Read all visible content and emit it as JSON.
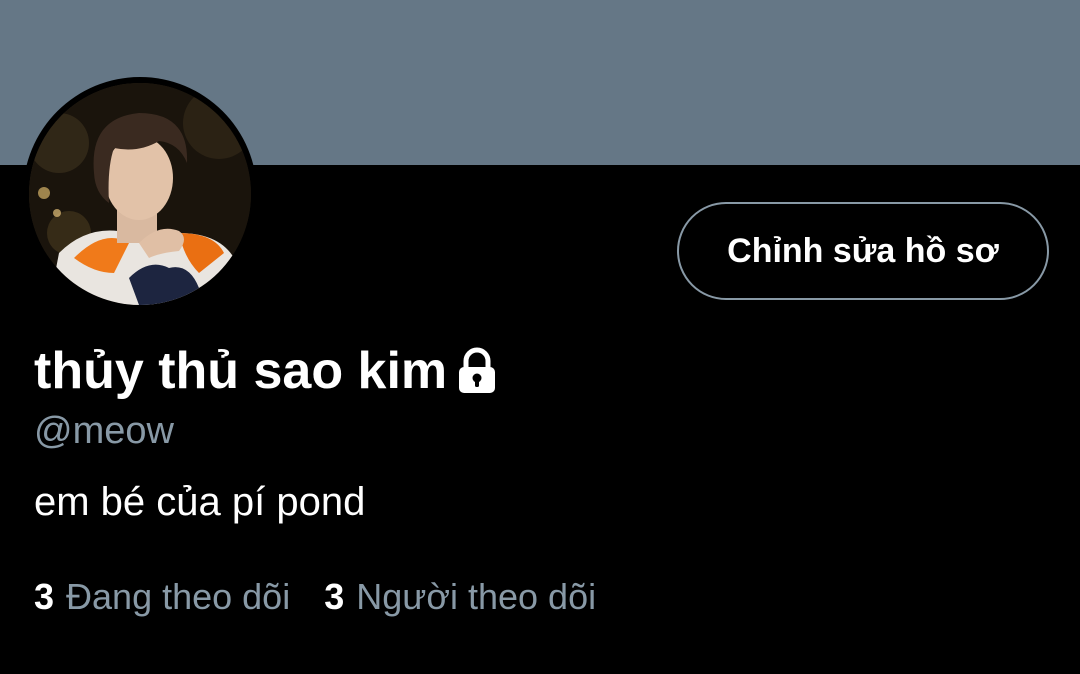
{
  "profile": {
    "display_name": "thủy thủ sao kim",
    "handle": "@meow",
    "bio": "em bé của pí pond",
    "protected_icon": "lock-icon",
    "avatar_description_icon": "avatar"
  },
  "actions": {
    "edit_profile_label": "Chỉnh sửa hồ sơ"
  },
  "stats": {
    "following_count": "3",
    "following_label": "Đang theo dõi",
    "followers_count": "3",
    "followers_label": "Người theo dõi"
  },
  "colors": {
    "background": "#000000",
    "banner": "#657786",
    "secondary_text": "#8899a6",
    "primary_text": "#ffffff",
    "button_border": "#8899a6"
  }
}
